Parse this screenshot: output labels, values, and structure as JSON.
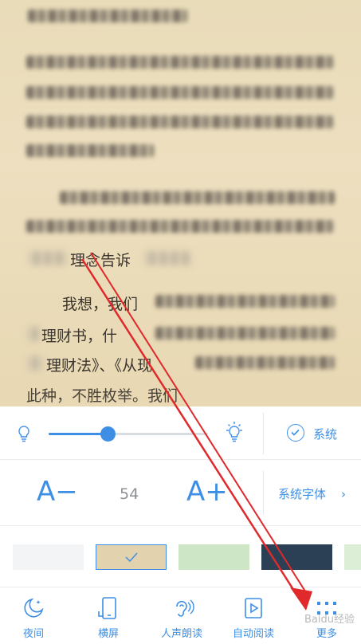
{
  "reader": {
    "fragments": [
      "理念告诉",
      "我想，我们",
      "理财书，什",
      "理财法》、《从现",
      "此种，不胜枚举。我们"
    ]
  },
  "settings": {
    "brightness": {
      "level": 0.37,
      "follow_system_label": "系统"
    },
    "font": {
      "decrease_label": "A−",
      "size": "54",
      "increase_label": "A+",
      "family_label": "系统字体",
      "chevron": "›"
    },
    "themes": [
      {
        "name": "white",
        "color": "#f3f4f5"
      },
      {
        "name": "parchment",
        "color": "#e2d2ad",
        "selected": true
      },
      {
        "name": "green",
        "color": "#cde6c6"
      },
      {
        "name": "navy",
        "color": "#2b3f55"
      },
      {
        "name": "pale-green",
        "color": "#dcefd6"
      }
    ]
  },
  "toolbar": {
    "items": [
      {
        "label": "夜间",
        "icon": "moon-icon"
      },
      {
        "label": "横屏",
        "icon": "rotate-phone-icon"
      },
      {
        "label": "人声朗读",
        "icon": "voice-read-icon"
      },
      {
        "label": "自动阅读",
        "icon": "play-icon"
      },
      {
        "label": "更多",
        "icon": "more-icon"
      }
    ]
  },
  "watermark": "Baidu经验",
  "colors": {
    "accent": "#3d8fe6",
    "arrow": "#e0292b",
    "page_bg": "#ede0bf"
  }
}
